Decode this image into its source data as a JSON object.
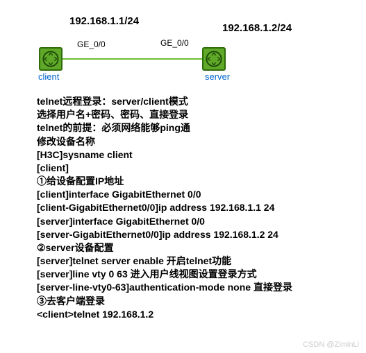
{
  "diagram": {
    "ip_left": "192.168.1.1/24",
    "ip_right": "192.168.1.2/24",
    "iface_left": "GE_0/0",
    "iface_right": "GE_0/0",
    "device_left": "client",
    "device_right": "server"
  },
  "lines": [
    "telnet远程登录：server/client模式",
    "选择用户名+密码、密码、直接登录",
    "telnet的前提：必须网络能够ping通",
    "修改设备名称",
    "[H3C]sysname client",
    "[client]",
    "①给设备配置IP地址",
    "[client]interface GigabitEthernet 0/0",
    "[client-GigabitEthernet0/0]ip address 192.168.1.1 24",
    "[server]interface GigabitEthernet 0/0",
    "[server-GigabitEthernet0/0]ip address 192.168.1.2 24",
    "②server设备配置",
    "[server]telnet server enable 开启telnet功能",
    "[server]line vty 0 63 进入用户线视图设置登录方式",
    "[server-line-vty0-63]authentication-mode none 直接登录",
    "③去客户端登录",
    "<client>telnet 192.168.1.2"
  ],
  "watermark": "CSDN @ZiminLi"
}
